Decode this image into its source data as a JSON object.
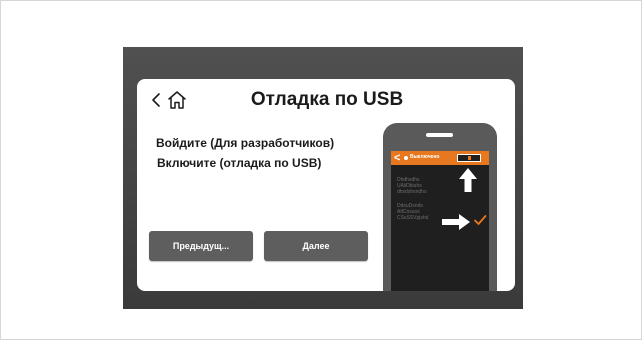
{
  "screen": {
    "title": "Отладка по USB",
    "instructions": [
      "Войдите (Для разработчиков)",
      "Включите (отладка по USB)"
    ],
    "buttons": {
      "prev_label": "Предыдущ...",
      "next_label": "Далее"
    },
    "icons": {
      "back": "chevron-left-icon",
      "home": "home-icon"
    }
  },
  "phone": {
    "status_label": "Выключено",
    "text_block_1": "Dhdhsdhs\nUAiiDbiuhs\ndhsdshsndhs",
    "text_block_2": "DdsuDsnds\nAtlCnsuos\nCSsSSVpjshd"
  },
  "colors": {
    "accent": "#e8781f",
    "button": "#5e5e5e",
    "frame": "#4a4a4a"
  }
}
